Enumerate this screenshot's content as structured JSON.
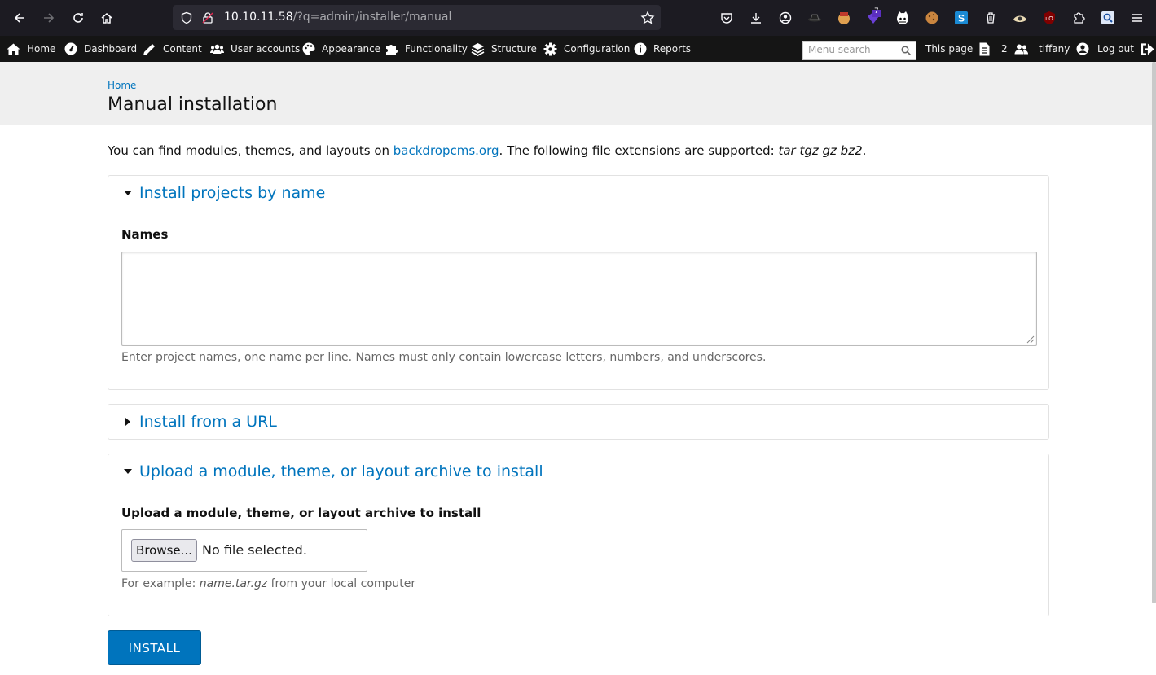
{
  "browser": {
    "url_host": "10.10.11.58",
    "url_path": "/?q=admin/installer/manual"
  },
  "extensions": [
    "pocket-icon",
    "download-icon",
    "account-icon",
    "spy-icon",
    "fox-ext-icon",
    "badge-ext-icon",
    "cat-ext-icon",
    "cookie-icon",
    "s-ext-icon",
    "trash-ext-icon",
    "wappalyzer-icon",
    "ublock-icon",
    "puzzle-icon",
    "search-ext-icon",
    "menu-icon"
  ],
  "extension_badge": "7",
  "admin_bar": {
    "items": [
      {
        "label": "Home",
        "icon": "house-icon"
      },
      {
        "label": "Dashboard",
        "icon": "dashboard-icon"
      },
      {
        "label": "Content",
        "icon": "pencil-icon"
      },
      {
        "label": "User accounts",
        "icon": "users-icon"
      },
      {
        "label": "Appearance",
        "icon": "palette-icon"
      },
      {
        "label": "Functionality",
        "icon": "puzzle-icon"
      },
      {
        "label": "Structure",
        "icon": "layers-icon"
      },
      {
        "label": "Configuration",
        "icon": "gear-icon"
      },
      {
        "label": "Reports",
        "icon": "info-icon"
      }
    ],
    "search_placeholder": "Menu search",
    "this_page": "This page",
    "user_count": "2",
    "username": "tiffany",
    "logout": "Log out"
  },
  "header": {
    "breadcrumb": "Home",
    "title": "Manual installation"
  },
  "intro": {
    "prefix": "You can find modules, themes, and layouts on ",
    "link": "backdropcms.org",
    "middle": ". The following file extensions are supported: ",
    "extensions": "tar tgz gz bz2",
    "suffix": "."
  },
  "fieldsets": {
    "by_name": {
      "legend": "Install projects by name",
      "label": "Names",
      "value": "",
      "description": "Enter project names, one name per line. Names must only contain lowercase letters, numbers, and underscores."
    },
    "from_url": {
      "legend": "Install from a URL"
    },
    "upload": {
      "legend": "Upload a module, theme, or layout archive to install",
      "label": "Upload a module, theme, or layout archive to install",
      "browse": "Browse...",
      "status": "No file selected.",
      "desc_prefix": "For example: ",
      "desc_example": "name.tar.gz",
      "desc_suffix": " from your local computer"
    }
  },
  "install_button": "INSTALL",
  "colors": {
    "link": "#0074bd",
    "admin_bar": "#151515",
    "browser_chrome": "#1c1b22"
  }
}
